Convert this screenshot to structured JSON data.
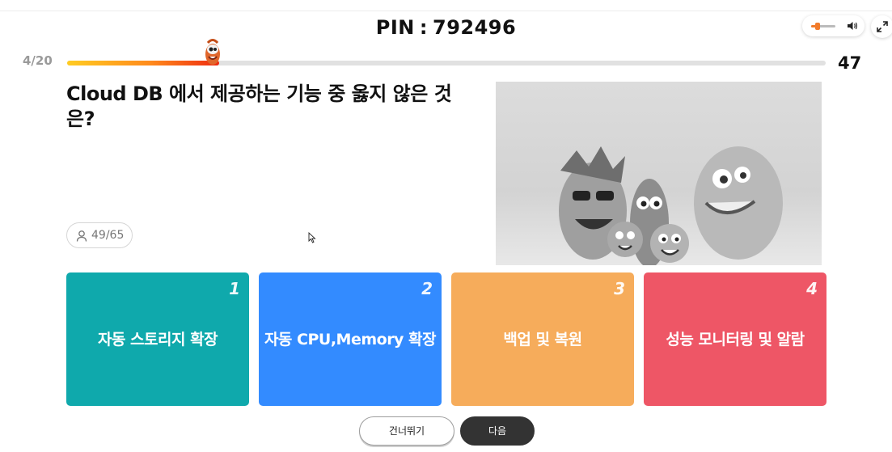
{
  "header": {
    "pin_label": "PIN",
    "pin_separator": ":",
    "pin_value": "792496",
    "volume_level": 0.25,
    "icons": {
      "volume": "speaker-icon",
      "expand": "expand-icon"
    }
  },
  "progress": {
    "counter": "4/20",
    "fraction": 0.2,
    "timer": "47",
    "colors": {
      "start": "#ffcc22",
      "end": "#ee2a10"
    }
  },
  "question": {
    "text": "Cloud DB 에서 제공하는 기능 중 옳지 않은 것은?",
    "answered": "49/65"
  },
  "answers": [
    {
      "number": "1",
      "label": "자동 스토리지 확장",
      "color": "#0fa9ac"
    },
    {
      "number": "2",
      "label": "자동 CPU,Memory 확장",
      "color": "#338bff"
    },
    {
      "number": "3",
      "label": "백업 및 복원",
      "color": "#f6ac5b"
    },
    {
      "number": "4",
      "label": "성능 모니터링 및 알람",
      "color": "#ee5666"
    }
  ],
  "buttons": {
    "skip": "건너뛰기",
    "next": "다음"
  }
}
